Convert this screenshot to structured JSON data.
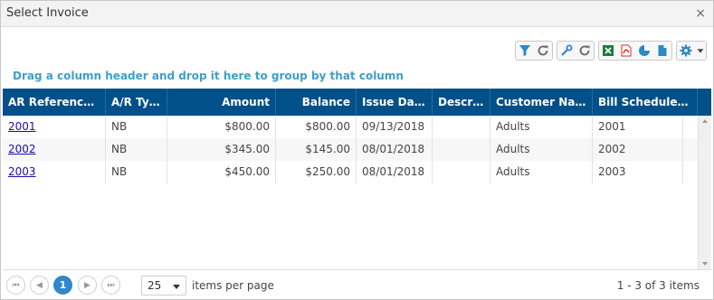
{
  "window": {
    "title": "Select Invoice",
    "close_glyph": "×"
  },
  "toolbar": {
    "icons": [
      "filter-icon",
      "refresh-icon",
      "wrench-icon",
      "refresh-icon",
      "excel-icon",
      "pdf-icon",
      "chart-icon",
      "document-icon",
      "gear-icon"
    ]
  },
  "grid": {
    "group_hint": "Drag a column header and drop it here to group by that column",
    "sort_glyph": "↑",
    "columns": [
      "AR Reference",
      "A/R Type",
      "Amount",
      "Balance",
      "Issue Date",
      "Descri...",
      "Customer Name",
      "Bill Schedule ..."
    ],
    "rows": [
      [
        "2001",
        "NB",
        "$800.00",
        "$800.00",
        "09/13/2018",
        "",
        "Adults",
        "2001"
      ],
      [
        "2002",
        "NB",
        "$345.00",
        "$145.00",
        "08/01/2018",
        "",
        "Adults",
        "2002"
      ],
      [
        "2003",
        "NB",
        "$450.00",
        "$250.00",
        "08/01/2018",
        "",
        "Adults",
        "2003"
      ]
    ]
  },
  "pager": {
    "current_page": "1",
    "page_size": "25",
    "items_per_page_label": "items per page",
    "info": "1 - 3 of 3 items"
  },
  "colors": {
    "header_bg": "#025089",
    "accent": "#3e9fc9",
    "active_page": "#2e88c9"
  }
}
